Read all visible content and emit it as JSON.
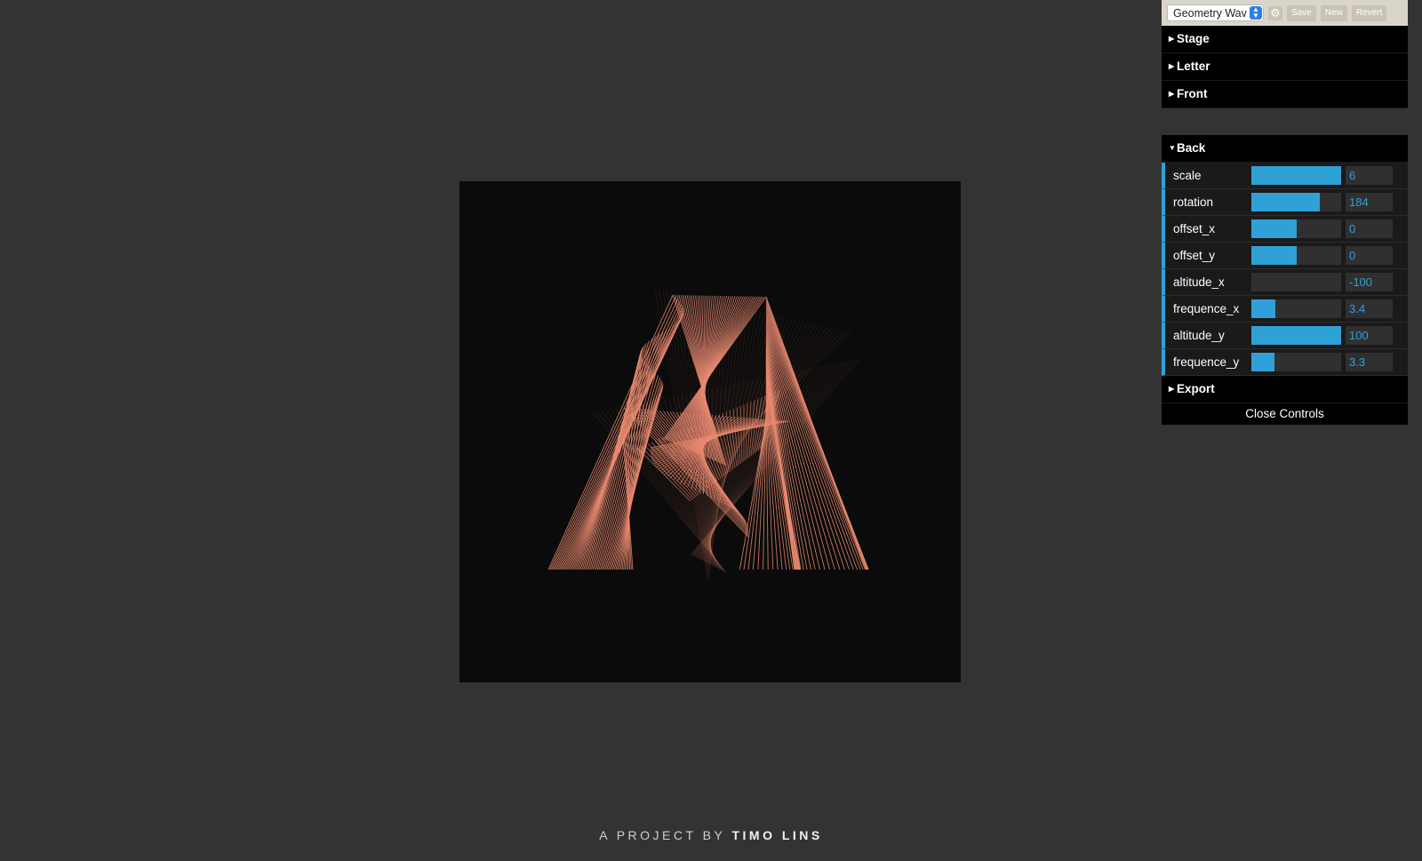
{
  "credit": {
    "prefix": "A PROJECT BY",
    "author": "TIMO LINS"
  },
  "colors": {
    "line": "#e98a70",
    "accent": "#2fa1d6",
    "stage_bg": "#0b0b0b"
  },
  "gui": {
    "preset": "Geometry Wav",
    "gear_icon": "gear-icon",
    "save": "Save",
    "new": "New",
    "revert": "Revert",
    "folders": {
      "stage": "Stage",
      "letter": "Letter",
      "front": "Front",
      "back": "Back",
      "export": "Export"
    },
    "back_controls": [
      {
        "label": "scale",
        "value": "6",
        "fill": 1.0
      },
      {
        "label": "rotation",
        "value": "184",
        "fill": 0.76
      },
      {
        "label": "offset_x",
        "value": "0",
        "fill": 0.5
      },
      {
        "label": "offset_y",
        "value": "0",
        "fill": 0.5
      },
      {
        "label": "altitude_x",
        "value": "-100",
        "fill": 0.0
      },
      {
        "label": "frequence_x",
        "value": "3.4",
        "fill": 0.27
      },
      {
        "label": "altitude_y",
        "value": "100",
        "fill": 1.0
      },
      {
        "label": "frequence_y",
        "value": "3.3",
        "fill": 0.26
      }
    ],
    "close": "Close Controls"
  }
}
